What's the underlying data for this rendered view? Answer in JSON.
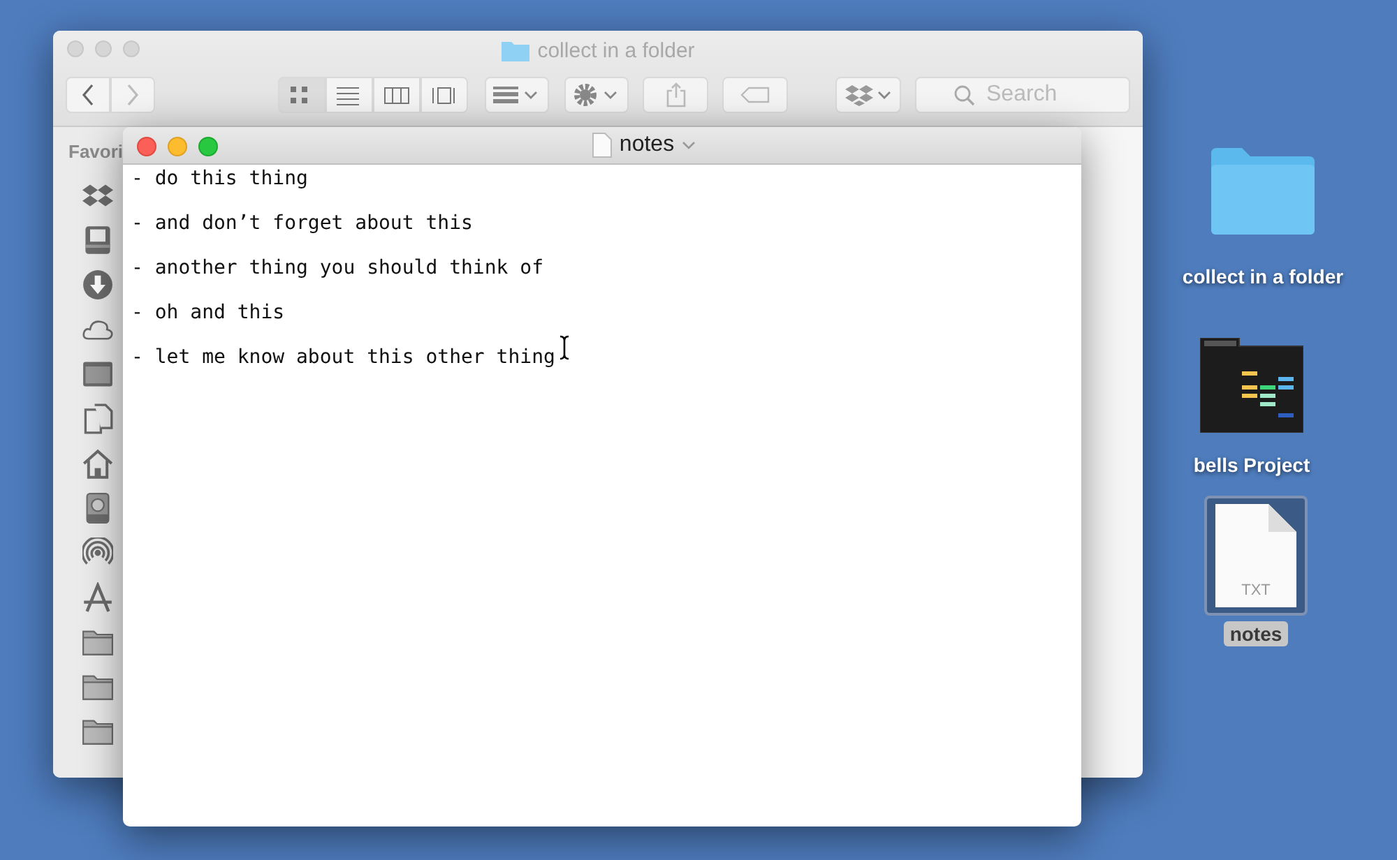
{
  "finder": {
    "title": "collect in a folder",
    "view_modes": [
      {
        "kind": "icons",
        "selected": true
      },
      {
        "kind": "list",
        "selected": false
      },
      {
        "kind": "columns",
        "selected": false
      },
      {
        "kind": "gallery",
        "selected": false
      }
    ],
    "search": {
      "placeholder": "Search"
    },
    "sidebar": {
      "heading": "Favori",
      "items": [
        {
          "kind": "dropbox"
        },
        {
          "kind": "tray"
        },
        {
          "kind": "download"
        },
        {
          "kind": "cloud"
        },
        {
          "kind": "window"
        },
        {
          "kind": "documents"
        },
        {
          "kind": "house"
        },
        {
          "kind": "disk"
        },
        {
          "kind": "airdrop"
        },
        {
          "kind": "apps"
        },
        {
          "kind": "folder"
        },
        {
          "kind": "folder"
        },
        {
          "kind": "folder"
        }
      ]
    }
  },
  "notes": {
    "title": "notes",
    "lines": [
      "- do this thing",
      "- and don’t forget about this",
      "- another thing you should think of",
      "- oh and this",
      "- let me know about this other thing"
    ]
  },
  "desktop_icons": [
    {
      "kind": "folder",
      "label": "collect in a folder",
      "selected": false
    },
    {
      "kind": "project",
      "label": "bells Project",
      "selected": false
    },
    {
      "kind": "text_file",
      "label": "notes",
      "badge": "TXT",
      "selected": true
    }
  ]
}
